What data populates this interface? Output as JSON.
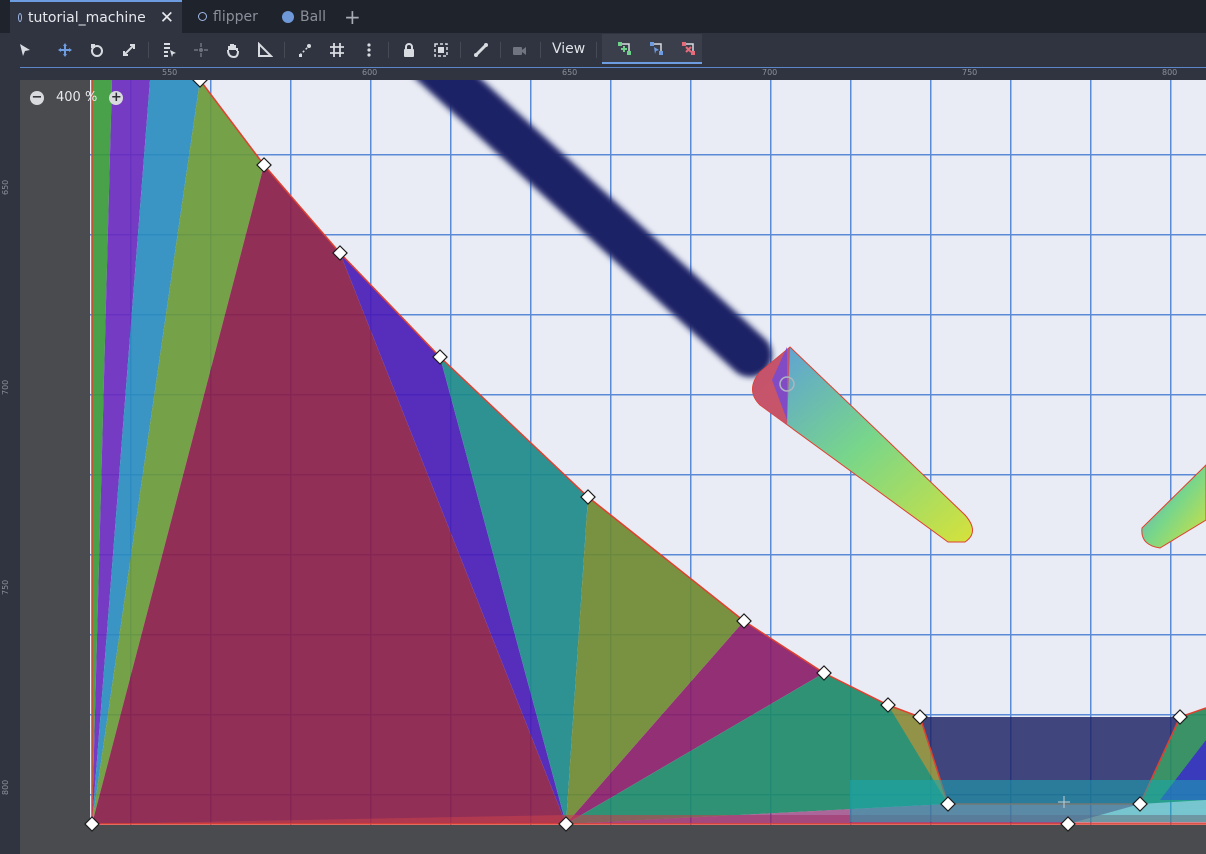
{
  "tabs": [
    {
      "label": "tutorial_machine",
      "icon": "scene-ring-icon",
      "active": true
    },
    {
      "label": "flipper",
      "icon": "scene-ring-icon",
      "active": false
    },
    {
      "label": "Ball",
      "icon": "globe-icon",
      "active": false
    }
  ],
  "add_tab_glyph": "+",
  "close_glyph": "✕",
  "toolbar": {
    "view_label": "View"
  },
  "zoom": {
    "level": "400 %",
    "minus": "−",
    "plus": "+"
  },
  "ruler": {
    "x_labels": [
      "550",
      "600",
      "650",
      "700",
      "750",
      "800"
    ],
    "y_labels": [
      "650",
      "700",
      "750",
      "800"
    ]
  },
  "colors": {
    "accent": "#6d9de0",
    "grid_line": "#5a8ad6",
    "grid_bg": "#e9ecf4",
    "polygon_outline": "#e04030"
  }
}
